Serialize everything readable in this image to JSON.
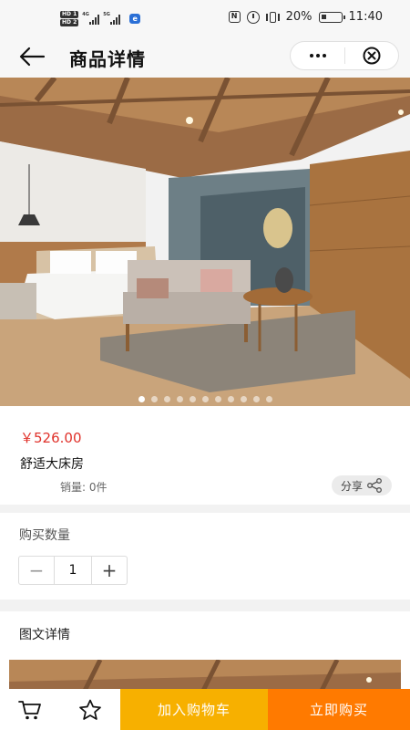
{
  "status_bar": {
    "hd1": "HD 1",
    "hd2": "HD 2",
    "net1": "4G",
    "net2": "5G",
    "battery_percent": "20%",
    "time": "11:40",
    "icons": [
      "signal-icon",
      "wechat-icon",
      "nfc-icon",
      "alarm-icon",
      "vibrate-icon",
      "battery-icon"
    ]
  },
  "header": {
    "title": "商品详情",
    "icons": [
      "back-arrow-icon",
      "more-dots-icon",
      "close-circle-icon"
    ]
  },
  "banner": {
    "slide_count": 11,
    "active_index": 0
  },
  "product": {
    "price": "￥526.00",
    "name": "舒适大床房",
    "sales": "销量: 0件",
    "share_label": "分享"
  },
  "quantity": {
    "label": "购买数量",
    "minus": "−",
    "value": "1",
    "plus": "+"
  },
  "details": {
    "title": "图文详情"
  },
  "bottom_bar": {
    "add_to_cart": "加入购物车",
    "buy_now": "立即购买",
    "icons": [
      "cart-icon",
      "star-icon"
    ]
  },
  "colors": {
    "price": "#e0322b",
    "add_to_cart": "#f7b000",
    "buy_now": "#ff7a00"
  }
}
